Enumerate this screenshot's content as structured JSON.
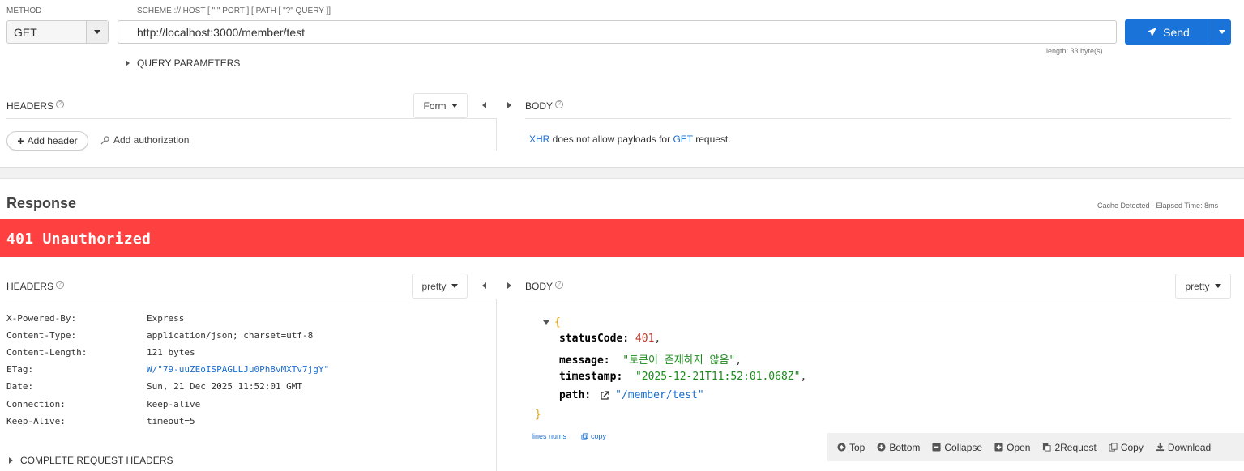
{
  "request": {
    "method_label": "METHOD",
    "method": "GET",
    "url_label": "SCHEME :// HOST [ \":\" PORT ] [ PATH [ \"?\" QUERY ]]",
    "url": "http://localhost:3000/member/test",
    "send_label": "Send",
    "length_info": "length: 33 byte(s)",
    "query_params_label": "QUERY PARAMETERS"
  },
  "request_headers": {
    "title": "HEADERS",
    "mode": "Form",
    "add_header": "Add header",
    "add_authorization": "Add authorization"
  },
  "request_body": {
    "title": "BODY",
    "msg_xhr": "XHR",
    "msg_mid": " does not allow payloads for ",
    "msg_get": "GET",
    "msg_end": " request."
  },
  "response": {
    "title": "Response",
    "cache_info": "Cache Detected - Elapsed Time: 8ms",
    "status": "401 Unauthorized",
    "status_color": "#ff4040",
    "headers_title": "HEADERS",
    "headers_mode": "pretty",
    "body_title": "BODY",
    "body_mode": "pretty",
    "headers": [
      {
        "key": "X-Powered-By:",
        "value": "Express"
      },
      {
        "key": "Content-Type:",
        "value": "application/json; charset=utf-8"
      },
      {
        "key": "Content-Length:",
        "value": "121 bytes"
      },
      {
        "key": "ETag:",
        "value": "W/\"79-uuZEoISPAGLLJu0Ph8vMXTv7jgY\""
      },
      {
        "key": "Date:",
        "value": "Sun, 21 Dec 2025 11:52:01 GMT"
      },
      {
        "key": "Connection:",
        "value": "keep-alive"
      },
      {
        "key": "Keep-Alive:",
        "value": "timeout=5"
      }
    ],
    "complete_headers_label": "COMPLETE REQUEST HEADERS",
    "body": {
      "open_brace": "{",
      "close_brace": "}",
      "statusCode_key": "statusCode:",
      "statusCode_val": "401",
      "message_key": "message:",
      "message_val": "\"토큰이 존재하지 않음\"",
      "timestamp_key": "timestamp:",
      "timestamp_val": "\"2025-12-21T11:52:01.068Z\"",
      "path_key": "path:",
      "path_val": "\"/member/test\"",
      "comma": ","
    },
    "lines_nums": "lines nums",
    "copy": "copy"
  },
  "toolbar": {
    "top": "Top",
    "bottom": "Bottom",
    "collapse": "Collapse",
    "open": "Open",
    "to_request": "2Request",
    "copy": "Copy",
    "download": "Download"
  }
}
